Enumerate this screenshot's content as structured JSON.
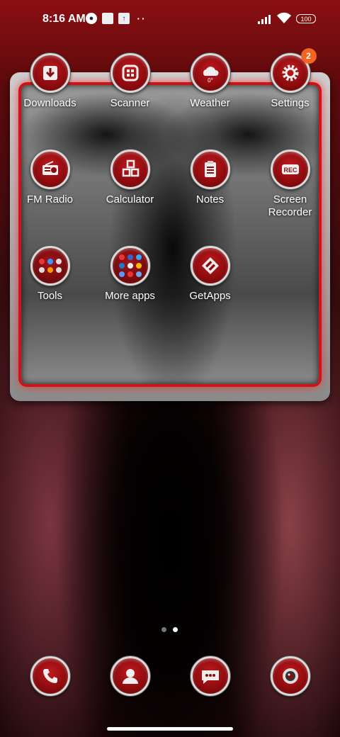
{
  "status_bar": {
    "time": "8:16 AM",
    "battery": "100"
  },
  "folder_apps": [
    {
      "label": "Downloads",
      "icon": "download-icon"
    },
    {
      "label": "Scanner",
      "icon": "scanner-icon"
    },
    {
      "label": "Weather",
      "icon": "cloud-icon",
      "icon_text": "0°"
    },
    {
      "label": "Settings",
      "icon": "gear-icon",
      "badge": "2"
    },
    {
      "label": "FM Radio",
      "icon": "radio-icon"
    },
    {
      "label": "Calculator",
      "icon": "cubes-icon"
    },
    {
      "label": "Notes",
      "icon": "clipboard-icon"
    },
    {
      "label": "Screen Recorder",
      "icon": "rec-icon",
      "icon_text": "REC"
    },
    {
      "label": "Tools",
      "icon": "folder-grid-icon"
    },
    {
      "label": "More apps",
      "icon": "folder-grid-icon"
    },
    {
      "label": "GetApps",
      "icon": "getapps-icon"
    }
  ],
  "page_indicator": {
    "pages": 2,
    "active": 2
  },
  "dock": [
    {
      "name": "phone-icon"
    },
    {
      "name": "contacts-icon"
    },
    {
      "name": "messages-icon"
    },
    {
      "name": "camera-icon"
    }
  ],
  "colors": {
    "accent_red": "#c8161a",
    "badge_orange": "#f26522"
  }
}
